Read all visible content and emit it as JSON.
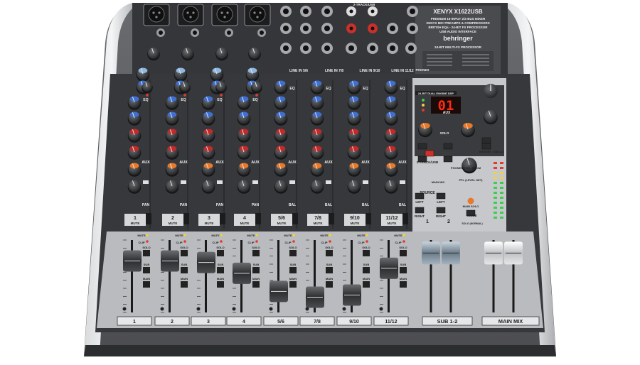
{
  "product": {
    "brand": "behringer",
    "model": "XENYX X1622USB",
    "features": [
      "PREMIUM 16-INPUT 2/2-BUS MIXER",
      "XENYX MIC PREAMPS & COMPRESSORS",
      "BRITISH EQs - 24-BIT FX PROCESSOR",
      "USB AUDIO INTERFACE"
    ],
    "fx_title": "24-BIT MULTI-FX PROCESSOR"
  },
  "display": {
    "header": "24-BIT DUAL ENGINE DSP",
    "value": "01"
  },
  "channels": [
    {
      "label": "1",
      "mute": "MUTE",
      "pan": "PAN",
      "fader": 0.72
    },
    {
      "label": "2",
      "mute": "MUTE",
      "pan": "PAN",
      "fader": 0.72
    },
    {
      "label": "3",
      "mute": "MUTE",
      "pan": "PAN",
      "fader": 0.7
    },
    {
      "label": "4",
      "mute": "MUTE",
      "pan": "PAN",
      "fader": 0.55
    },
    {
      "label": "5/6",
      "mute": "MUTE",
      "pan": "BAL",
      "fader": 0.3
    },
    {
      "label": "7/8",
      "mute": "MUTE",
      "pan": "BAL",
      "fader": 0.22
    },
    {
      "label": "9/10",
      "mute": "MUTE",
      "pan": "BAL",
      "fader": 0.25
    },
    {
      "label": "11/12",
      "mute": "MUTE",
      "pan": "BAL",
      "fader": 0.62
    }
  ],
  "top_row_labels": [
    "LINE IN 5/6",
    "LINE IN 7/8",
    "LINE IN 9/10",
    "LINE IN 11/12"
  ],
  "section_labels": {
    "eq": "EQ",
    "aux": "AUX",
    "fx": "FX",
    "comp": "COMP",
    "clip": "CLIP",
    "solo": "SOLO",
    "sub": "SUB",
    "main": "MAIN",
    "two_track_usb": "2-TRACK/USB",
    "phones": "PHONES",
    "source": "SOURCE",
    "left": "LEFT",
    "right": "RIGHT",
    "main_mix_tab": "MAIN MIX",
    "sub_12_tab": "SUB 1-2",
    "phones_ctrl_room": "PHONES/CTRL ROOM",
    "pfl_level_set": "PFL (LEVEL SET)",
    "main_solo": "MAIN SOLO",
    "mode": "MODE",
    "solo_normal": "SOLO (NORMAL)",
    "main_mix_sub": "MAIN MIX→SUB 1-2"
  },
  "bus_faders": [
    {
      "label": "SUB 1-2",
      "level": 0.84
    },
    {
      "label": "MAIN MIX",
      "level": 0.84
    }
  ],
  "sub_group_labels": [
    "1",
    "2"
  ],
  "colors": {
    "body": "#5c5d60",
    "faceplate": "#3a3b3e",
    "rail": "#cfd1d4",
    "knob_blue": "#3f6fd0",
    "knob_red": "#c42a2a",
    "knob_orange": "#e8792a",
    "knob_cap_light": "#8fb7e0",
    "led_green": "#3bd04a",
    "led_yellow": "#f4d13a",
    "led_red": "#e43a2a",
    "display_red": "#ff2a14"
  }
}
